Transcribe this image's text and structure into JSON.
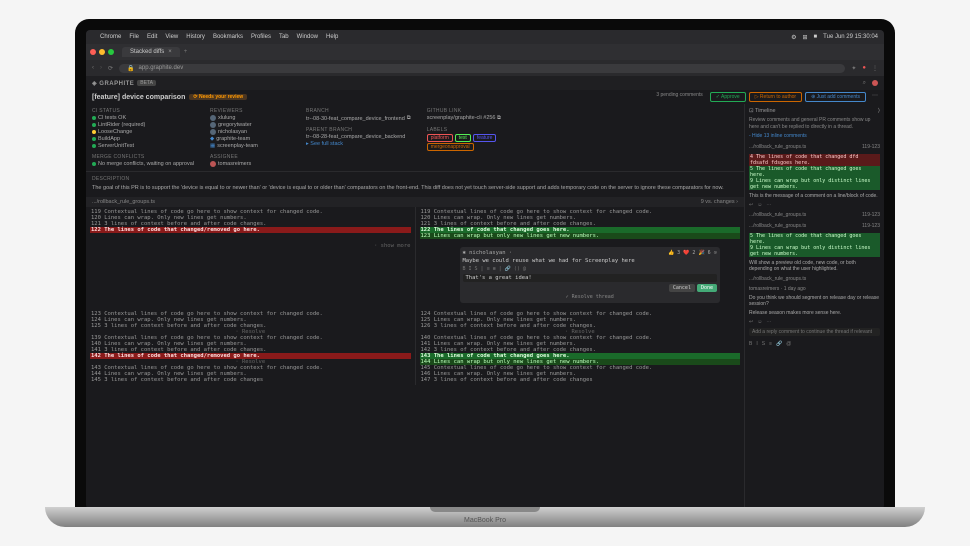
{
  "menubar": {
    "items": [
      "Chrome",
      "File",
      "Edit",
      "View",
      "History",
      "Bookmarks",
      "Profiles",
      "Tab",
      "Window",
      "Help"
    ],
    "time": "Tue Jun 29  15:30:04"
  },
  "tab": {
    "title": "Stacked diffs",
    "close": "×"
  },
  "url": {
    "lock": "🔒",
    "host": "app.graphite.dev"
  },
  "brand": {
    "name": "◈ GRAPHITE",
    "beta": "BETA"
  },
  "pr": {
    "title": "[feature] device comparison",
    "review_badge": "⟳ Needs your review",
    "pending": "3 pending comments",
    "approve": "✓ Approve",
    "return": "▷ Return to author",
    "add": "⊕ Just add comments"
  },
  "meta": {
    "ci": {
      "label": "CI STATUS",
      "items": [
        "CI tests OK",
        "LintRider (required)",
        "LooseChange",
        "BuildApp",
        "ServerUnitTest"
      ]
    },
    "merge": {
      "label": "MERGE CONFLICTS",
      "text": "No merge conflicts, waiting on approval"
    },
    "reviewers": {
      "label": "REVIEWERS",
      "items": [
        "xlulung",
        "gregorytwater",
        "nicholasyan",
        "graphite-team",
        "screenplay-team"
      ]
    },
    "assignee": {
      "label": "ASSIGNEE",
      "name": "tomasreimers"
    },
    "branch": {
      "label": "BRANCH",
      "name": "tr--08-30-feat_compare_device_frontend",
      "copy": "⧉"
    },
    "parent": {
      "label": "PARENT BRANCH",
      "name": "tr--08-28-feat_compare_device_backend",
      "link": "▸ See full stack"
    },
    "github": {
      "label": "GITHUB LINK",
      "text": "screenplay/graphite-cli #256 ⧉"
    },
    "labels": {
      "label": "LABELS",
      "items": [
        "platform",
        "test",
        "feature",
        "mergeonapproval"
      ]
    }
  },
  "desc": {
    "label": "DESCRIPTION",
    "text": "The goal of this PR is to support the 'device is equal to or newer than' or 'device is equal to or older than' comparators on the front-end. This diff does not yet touch server-side support and adds temporary code on the server to ignore these comparators for now."
  },
  "file": {
    "path": ".../rollback_rule_groups.ts",
    "note": "· show more",
    "right_note": "9 vs. changes ›"
  },
  "diff": {
    "left": [
      {
        "n": "119",
        "t": "Contextual lines of code go here to show context for changed code."
      },
      {
        "n": "120",
        "t": "Lines can wrap. Only new lines get numbers."
      },
      {
        "n": "121",
        "t": "3 lines of context before and after code changes."
      },
      {
        "n": "122",
        "t": "The lines of code that changed/removed go here.",
        "c": "markr"
      }
    ],
    "right": [
      {
        "n": "119",
        "t": "Contextual lines of code go here to show context for changed code."
      },
      {
        "n": "120",
        "t": "Lines can wrap. Only new lines get numbers."
      },
      {
        "n": "121",
        "t": "3 lines of context before and after code changes."
      },
      {
        "n": "122",
        "t": "The lines of code that changed goes here.",
        "c": "markg"
      },
      {
        "n": "123",
        "t": "Lines can wrap but only new lines get new numbers.",
        "c": "added"
      }
    ],
    "left2": [
      {
        "n": "123",
        "t": "Contextual lines of code go here to show context for changed code."
      },
      {
        "n": "124",
        "t": "Lines can wrap. Only new lines get numbers."
      },
      {
        "n": "125",
        "t": "3 lines of context before and after code changes."
      },
      {
        "t": "· Resolve",
        "note": true
      },
      {
        "n": "139",
        "t": "Contextual lines of code go here to show context for changed code."
      },
      {
        "n": "140",
        "t": "Lines can wrap. Only new lines get numbers."
      },
      {
        "n": "141",
        "t": "3 lines of context before and after code changes."
      },
      {
        "n": "142",
        "t": "The lines of code that changed/removed go here.",
        "c": "markr"
      },
      {
        "t": "· Resolve",
        "note": true
      },
      {
        "n": "143",
        "t": "Contextual lines of code go here to show context for changed code."
      },
      {
        "n": "144",
        "t": "Lines can wrap. Only new lines get numbers."
      },
      {
        "n": "145",
        "t": "3 lines of context before and after code changes"
      }
    ],
    "right2": [
      {
        "n": "124",
        "t": "Contextual lines of code go here to show context for changed code."
      },
      {
        "n": "125",
        "t": "Lines can wrap. Only new lines get numbers."
      },
      {
        "n": "126",
        "t": "3 lines of context before and after code changes."
      },
      {
        "t": "· Resolve",
        "note": true
      },
      {
        "n": "140",
        "t": "Contextual lines of code go here to show context for changed code."
      },
      {
        "n": "141",
        "t": "Lines can wrap. Only new lines get numbers."
      },
      {
        "n": "142",
        "t": "3 lines of context before and after code changes."
      },
      {
        "n": "143",
        "t": "The lines of code that changed goes here.",
        "c": "markg"
      },
      {
        "n": "144",
        "t": "Lines can wrap but only new lines get new numbers.",
        "c": "added"
      },
      {
        "n": "145",
        "t": "Contextual lines of code go here to show context for changed code."
      },
      {
        "n": "146",
        "t": "Lines can wrap. Only new lines get numbers."
      },
      {
        "n": "147",
        "t": "3 lines of context before and after code changes"
      }
    ]
  },
  "comment": {
    "author": "✱ nicholasyan ·",
    "reactions": [
      "👍 3",
      "❤️ 2",
      "🎉 6"
    ],
    "text": "Maybe we could reuse what we had for Screenplay here",
    "reply": "That's a great idea!",
    "cancel": "Cancel",
    "done": "Done",
    "resolve": "✓ Resolve thread"
  },
  "timeline": {
    "header": "⊡ Timeline",
    "note": "Review comments and general PR comments show up here and can't be replied to directly in a thread.",
    "hide": "- Hide 13 inline comments",
    "f1": ".../rollback_rule_groups.ts",
    "l1": "119-123",
    "s1": {
      "r": "4 The lines of code that changed dfd fdsafd fdsgoes here.",
      "g": "5 The lines of code that changed goes here.",
      "g2": "9 Lines can wrap but only distinct lines get new numbers."
    },
    "c1": "This is the message of a comment on a line/block of code.",
    "f2": ".../rollback_rule_groups.ts",
    "l2": "119-123",
    "f3": ".../rollback_rule_groups.ts",
    "l3": "119-123",
    "s2": {
      "g": "5 The lines of code that changed goes here.",
      "g2": "9 Lines can wrap but only distinct lines get new numbers."
    },
    "c2": "Will show a preview old code, new code, or both depending on what the user highlighted.",
    "f4": ".../rollback_rule_groups.ts",
    "c3": {
      "author": "tomasreimers · 1 day ago",
      "text": "Do you think we should segment on release day or release session?"
    },
    "c4": "Release season makes more sense here.",
    "reply_ph": "Add a reply comment to continue the thread if relevant"
  },
  "mbp": "MacBook Pro"
}
